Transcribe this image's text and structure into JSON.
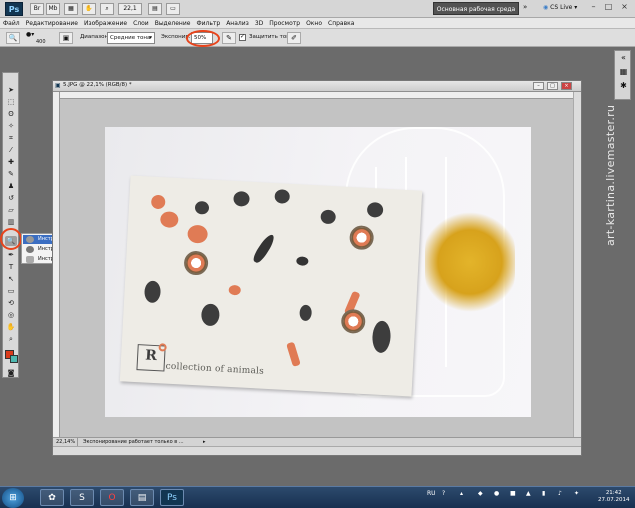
{
  "app": {
    "logo": "Ps",
    "zoom_box": "22,1",
    "workspace": "Основная рабочая среда",
    "cslive": "CS Live",
    "minimize": "–",
    "maximize": "□",
    "close": "×"
  },
  "menu": [
    "Файл",
    "Редактирование",
    "Изображение",
    "Слои",
    "Выделение",
    "Фильтр",
    "Анализ",
    "3D",
    "Просмотр",
    "Окно",
    "Справка"
  ],
  "options": {
    "brush_size": "400",
    "range_label": "Диапазон:",
    "range_value": "Средние тона",
    "exposure_label": "Экспонир.:",
    "exposure_value": "50%",
    "protect_tones": "Защитить тона"
  },
  "flyout": {
    "items": [
      {
        "label": "Инструмент \"Осветлитель\"",
        "key": "O"
      },
      {
        "label": "Инструмент \"Затемнитель\"",
        "key": "O"
      },
      {
        "label": "Инструмент \"Губка\"",
        "key": "O"
      }
    ]
  },
  "document": {
    "title": "5.JPG @ 22,1% (RGB/8) *",
    "zoom_status": "22,14%",
    "status_text": "Экспонирование работает только в ...",
    "caption": "collection of animals",
    "logo_letters": "R"
  },
  "watermark": "art-kartina.livemaster.ru",
  "taskbar": {
    "lang": "RU",
    "time": "21:42",
    "date": "27.07.2014"
  },
  "colors": {
    "accent_ring": "#e8441c",
    "foreground": "#d93b1b",
    "background": "#4db8b0"
  }
}
